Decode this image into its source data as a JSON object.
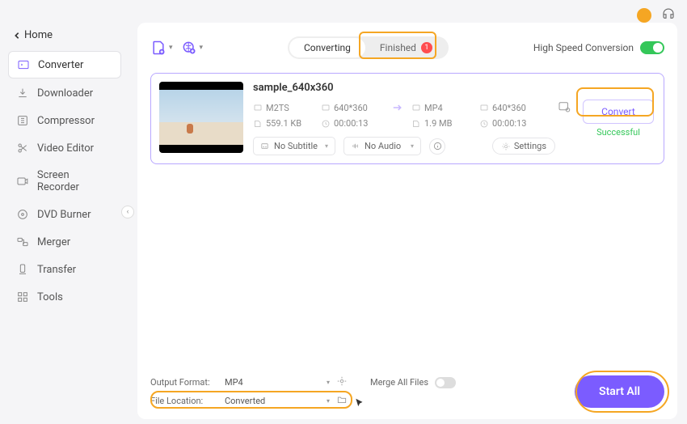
{
  "window": {
    "home_label": "Home"
  },
  "sidebar": {
    "items": [
      {
        "label": "Converter",
        "icon": "converter"
      },
      {
        "label": "Downloader",
        "icon": "downloader"
      },
      {
        "label": "Compressor",
        "icon": "compressor"
      },
      {
        "label": "Video Editor",
        "icon": "editor"
      },
      {
        "label": "Screen Recorder",
        "icon": "recorder"
      },
      {
        "label": "DVD Burner",
        "icon": "dvd"
      },
      {
        "label": "Merger",
        "icon": "merger"
      },
      {
        "label": "Transfer",
        "icon": "transfer"
      },
      {
        "label": "Tools",
        "icon": "tools"
      }
    ],
    "active_index": 0
  },
  "tabs": {
    "converting": "Converting",
    "finished": "Finished",
    "finished_count": "1",
    "active": "converting"
  },
  "high_speed": {
    "label": "High Speed Conversion",
    "on": true
  },
  "file": {
    "name": "sample_640x360",
    "src": {
      "format": "M2TS",
      "res": "640*360",
      "size": "559.1 KB",
      "dur": "00:00:13"
    },
    "dst": {
      "format": "MP4",
      "res": "640*360",
      "size": "1.9 MB",
      "dur": "00:00:13"
    },
    "subtitle": {
      "label": "No Subtitle"
    },
    "audio": {
      "label": "No Audio"
    },
    "settings_label": "Settings",
    "convert_label": "Convert",
    "status": "Successful"
  },
  "bottom": {
    "output_format_label": "Output Format:",
    "output_format_value": "MP4",
    "file_location_label": "File Location:",
    "file_location_value": "Converted",
    "merge_label": "Merge All Files",
    "start_all": "Start All"
  }
}
